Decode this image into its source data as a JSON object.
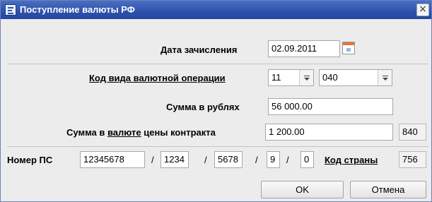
{
  "window": {
    "title": "Поступление валюты РФ",
    "close_glyph": "×"
  },
  "form": {
    "date_label": "Дата зачисления",
    "date_value": "02.09.2011",
    "opcode_label": "Код вида валютной операции",
    "opcode_part1": "11",
    "opcode_part2": "040",
    "rub_label": "Сумма в рублях",
    "rub_value": "56 000.00",
    "curr_label_prefix": "Сумма в",
    "curr_label_link": "валюте",
    "curr_label_suffix": "цены контракта",
    "curr_value": "1 200.00",
    "curr_code": "840",
    "ps_label": "Номер ПС",
    "ps_part1": "12345678",
    "ps_part2": "1234",
    "ps_part3": "5678",
    "ps_part4": "9",
    "ps_part5": "0",
    "slash": "/",
    "country_label": "Код страны",
    "country_code": "756"
  },
  "buttons": {
    "ok": "OK",
    "cancel": "Отмена"
  },
  "icons": {
    "app": "document-app-icon",
    "calendar": "calendar-icon",
    "dropdown": "dropdown-arrow-icon"
  },
  "colors": {
    "titlebar": "#2f54ad",
    "dialog_bg": "#ececec"
  }
}
